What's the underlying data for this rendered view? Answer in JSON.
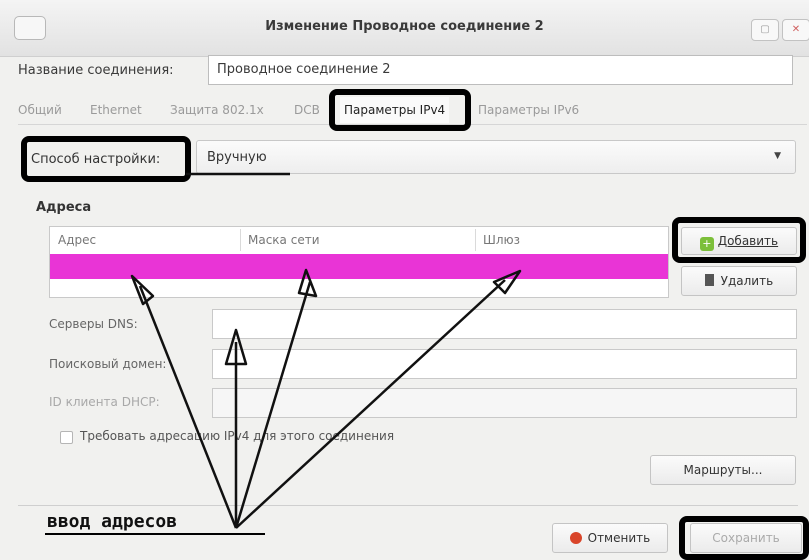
{
  "window": {
    "title": "Изменение Проводное соединение 2"
  },
  "connection": {
    "name_label": "Название соединения:",
    "name_value": "Проводное соединение 2"
  },
  "tabs": [
    {
      "label": "Общий"
    },
    {
      "label": "Ethernet"
    },
    {
      "label": "Защита 802.1x"
    },
    {
      "label": "DCB"
    },
    {
      "label": "Параметры IPv4"
    },
    {
      "label": "Параметры IPv6"
    }
  ],
  "ipv4": {
    "method_label": "Способ настройки:",
    "method_value": "Вручную",
    "addresses_heading": "Адреса",
    "columns": [
      "Адрес",
      "Маска сети",
      "Шлюз"
    ],
    "add_button": "Добавить",
    "delete_button": "Удалить",
    "dns_label": "Серверы DNS:",
    "search_domain_label": "Поисковый домен:",
    "dhcp_client_label": "ID клиента DHCP:",
    "require_ipv4_label": "Требовать адресацию IPv4 для этого соединения",
    "routes_button": "Маршруты..."
  },
  "footer": {
    "cancel_button": "Отменить",
    "save_button": "Сохранить"
  },
  "annotation": {
    "caption": "ввод адресов"
  },
  "colors": {
    "selected_row": "#e934d6",
    "highlight_frame": "#000000"
  },
  "icons": {
    "add": "plus-icon",
    "delete": "trash-icon",
    "cancel": "cancel-icon",
    "save": "save-icon"
  }
}
